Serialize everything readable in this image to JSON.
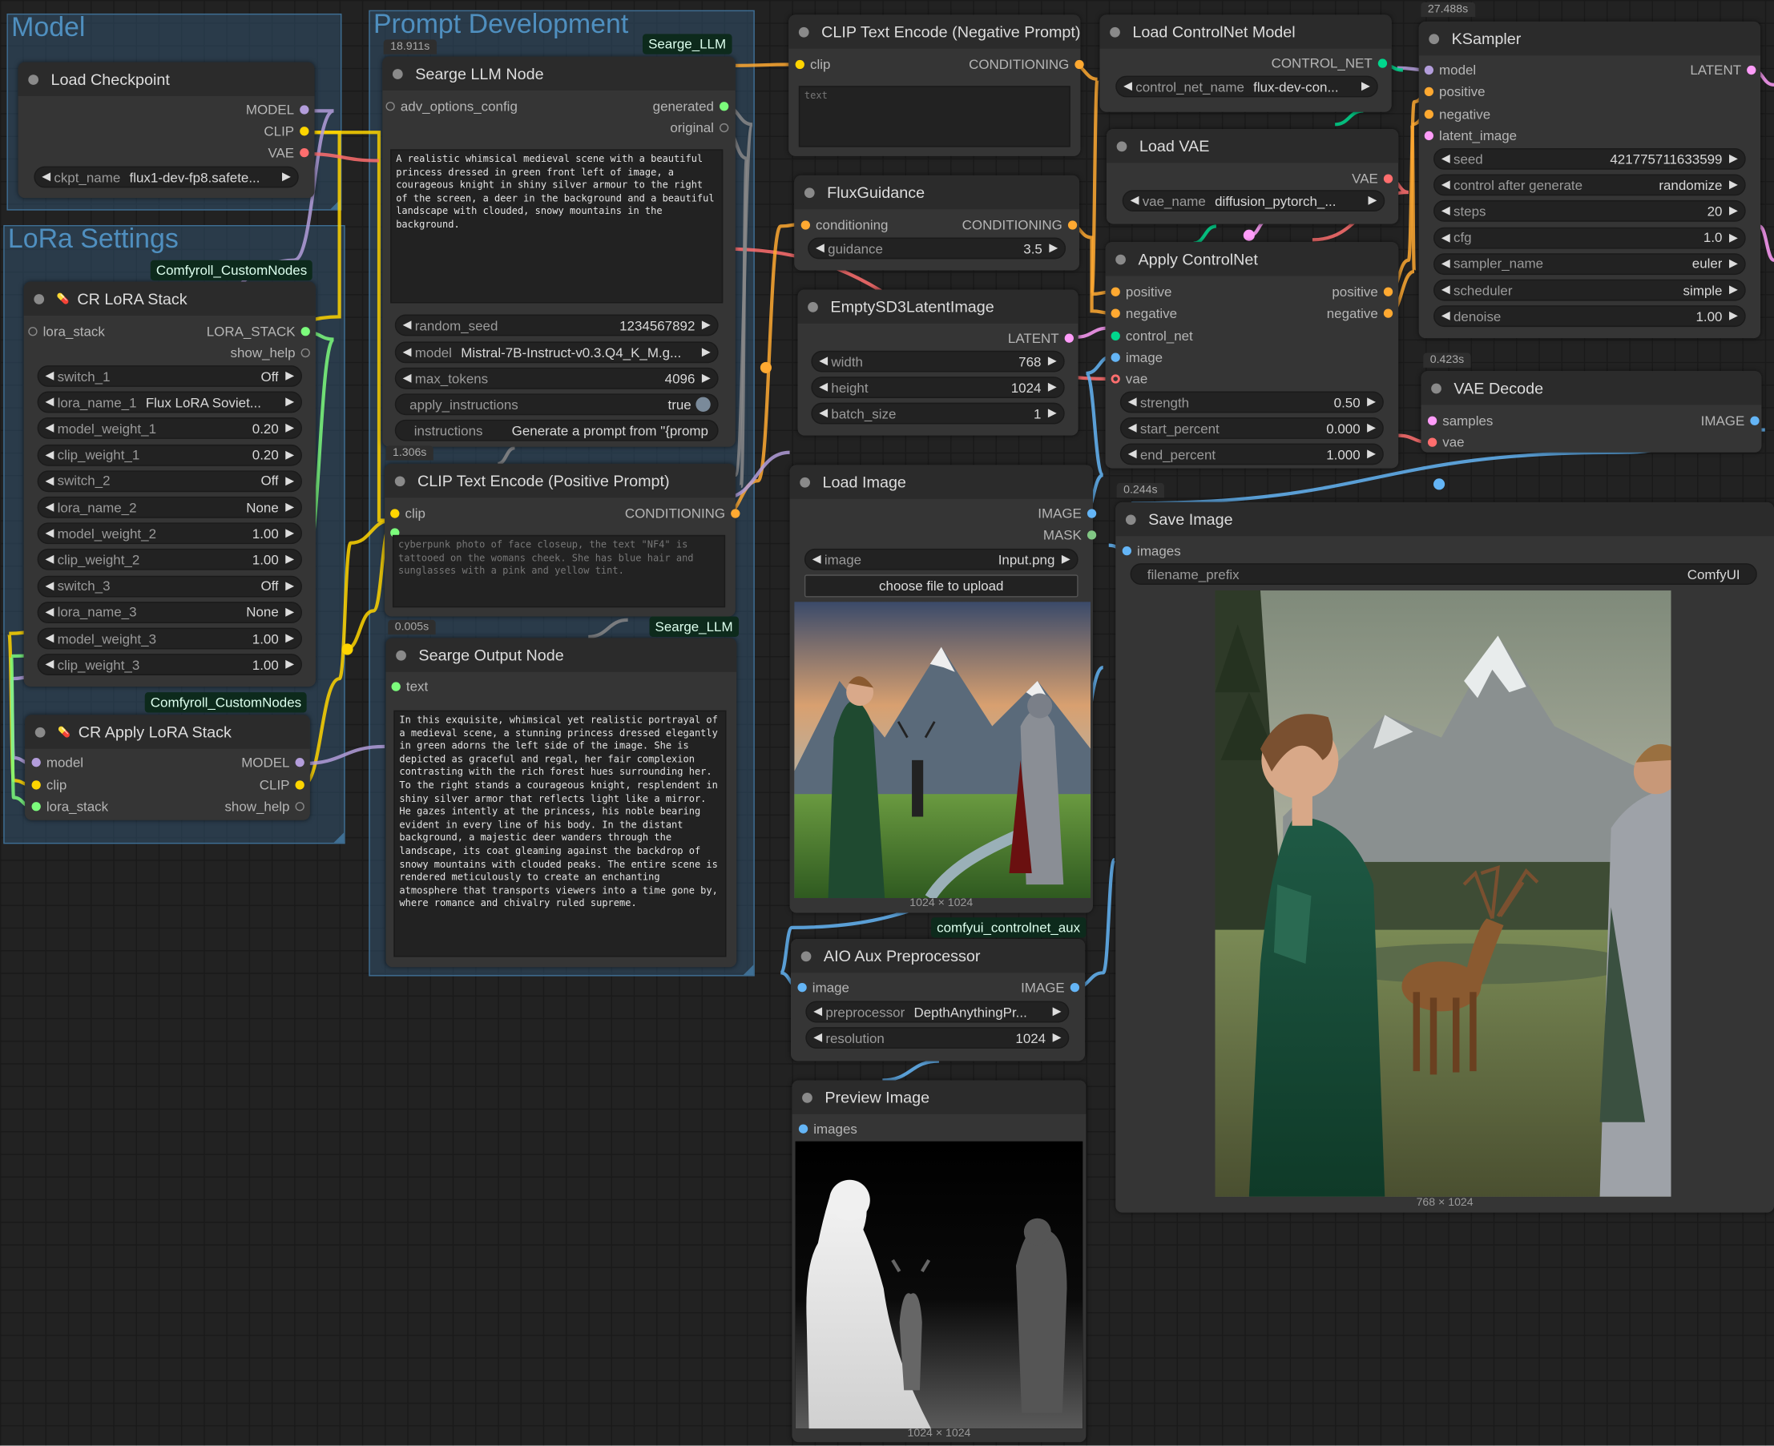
{
  "groups": {
    "model": "Model",
    "prompt": "Prompt Development",
    "lora": "LoRa Settings"
  },
  "badges": {
    "seargellm1": "Searge_LLM",
    "seargellm2": "Searge_LLM",
    "comfyroll1": "Comfyroll_CustomNodes",
    "comfyroll2": "Comfyroll_CustomNodes",
    "controlnetaux": "comfyui_controlnet_aux"
  },
  "times": {
    "llm": "18.911s",
    "clippos": "1.306s",
    "output": "0.005s",
    "ksampler": "27.488s",
    "vaedecode": "0.423s",
    "save": "0.244s"
  },
  "colors": {
    "model": "#b39ddb",
    "clip": "#ffd500",
    "vae": "#ff6e6e",
    "conditioning": "#ffa931",
    "latent": "#ff9cf9",
    "image": "#64b5f6",
    "mask": "#81c784",
    "control_net": "#00d78d",
    "text": "#7cfc7c",
    "lora_stack": "#7cfc7c",
    "generic": "#888888"
  },
  "nodes": {
    "load_checkpoint": {
      "title": "Load Checkpoint",
      "out_model": "MODEL",
      "out_clip": "CLIP",
      "out_vae": "VAE",
      "ckpt_label": "ckpt_name",
      "ckpt_value": "flux1-dev-fp8.safete..."
    },
    "searge_llm": {
      "title": "Searge LLM Node",
      "in_adv": "adv_options_config",
      "out_generated": "generated",
      "out_original": "original",
      "prompt": "A realistic whimsical medieval scene with a beautiful princess dressed in green front left of image, a courageous knight in shiny silver armour to the right of the screen, a deer in the background and a beautiful landscape with clouded, snowy mountains in the background.",
      "w_random_seed": "random_seed",
      "v_random_seed": "1234567892",
      "w_model": "model",
      "v_model": "Mistral-7B-Instruct-v0.3.Q4_K_M.g...",
      "w_max_tokens": "max_tokens",
      "v_max_tokens": "4096",
      "w_apply": "apply_instructions",
      "v_apply": "true",
      "w_instructions": "instructions",
      "v_instructions": "Generate a prompt from \"{promp"
    },
    "cr_lora_stack": {
      "title": "CR LoRA Stack",
      "in_lora_stack": "lora_stack",
      "out_lora_stack": "LORA_STACK",
      "out_show_help": "show_help",
      "widgets": [
        {
          "label": "switch_1",
          "value": "Off"
        },
        {
          "label": "lora_name_1",
          "value": "Flux LoRA Soviet..."
        },
        {
          "label": "model_weight_1",
          "value": "0.20"
        },
        {
          "label": "clip_weight_1",
          "value": "0.20"
        },
        {
          "label": "switch_2",
          "value": "Off"
        },
        {
          "label": "lora_name_2",
          "value": "None"
        },
        {
          "label": "model_weight_2",
          "value": "1.00"
        },
        {
          "label": "clip_weight_2",
          "value": "1.00"
        },
        {
          "label": "switch_3",
          "value": "Off"
        },
        {
          "label": "lora_name_3",
          "value": "None"
        },
        {
          "label": "model_weight_3",
          "value": "1.00"
        },
        {
          "label": "clip_weight_3",
          "value": "1.00"
        }
      ]
    },
    "cr_apply_lora": {
      "title": "CR Apply LoRA Stack",
      "in_model": "model",
      "in_clip": "clip",
      "in_lora_stack": "lora_stack",
      "out_model": "MODEL",
      "out_clip": "CLIP",
      "out_show_help": "show_help"
    },
    "clip_positive": {
      "title": "CLIP Text Encode (Positive Prompt)",
      "in_clip": "clip",
      "out_cond": "CONDITIONING",
      "text": "cyberpunk photo of face closeup, the text \"NF4\" is tattooed on the womans cheek. She has blue hair and sunglasses with a pink and yellow tint."
    },
    "searge_output": {
      "title": "Searge Output Node",
      "in_text": "text",
      "text": "In this exquisite, whimsical yet realistic portrayal of a medieval scene, a stunning princess dressed elegantly in green adorns the left side of the image. She is depicted as graceful and regal, her fair complexion contrasting with the rich forest hues surrounding her. To the right stands a courageous knight, resplendent in shiny silver armor that reflects light like a mirror. He gazes intently at the princess, his noble bearing evident in every line of his body. In the distant background, a majestic deer wanders through the landscape, its coat gleaming against the backdrop of snowy mountains with clouded peaks. The entire scene is rendered meticulously to create an enchanting atmosphere that transports viewers into a time gone by, where romance and chivalry ruled supreme."
    },
    "clip_negative": {
      "title": "CLIP Text Encode (Negative Prompt)",
      "in_clip": "clip",
      "out_cond": "CONDITIONING",
      "placeholder": "text"
    },
    "flux_guidance": {
      "title": "FluxGuidance",
      "in_cond": "conditioning",
      "out_cond": "CONDITIONING",
      "w_guidance": "guidance",
      "v_guidance": "3.5"
    },
    "empty_latent": {
      "title": "EmptySD3LatentImage",
      "out_latent": "LATENT",
      "w_width": "width",
      "v_width": "768",
      "w_height": "height",
      "v_height": "1024",
      "w_batch": "batch_size",
      "v_batch": "1"
    },
    "load_image": {
      "title": "Load Image",
      "out_image": "IMAGE",
      "out_mask": "MASK",
      "w_image": "image",
      "v_image": "Input.png",
      "upload": "choose file to upload",
      "dims": "1024 × 1024"
    },
    "aio_aux": {
      "title": "AIO Aux Preprocessor",
      "in_image": "image",
      "out_image": "IMAGE",
      "w_pre": "preprocessor",
      "v_pre": "DepthAnythingPr...",
      "w_res": "resolution",
      "v_res": "1024"
    },
    "preview_image": {
      "title": "Preview Image",
      "in_images": "images",
      "dims": "1024 × 1024"
    },
    "load_controlnet": {
      "title": "Load ControlNet Model",
      "out_cn": "CONTROL_NET",
      "w_name": "control_net_name",
      "v_name": "flux-dev-con..."
    },
    "load_vae": {
      "title": "Load VAE",
      "out_vae": "VAE",
      "w_name": "vae_name",
      "v_name": "diffusion_pytorch_..."
    },
    "apply_controlnet": {
      "title": "Apply ControlNet",
      "in_positive": "positive",
      "in_negative": "negative",
      "in_cn": "control_net",
      "in_image": "image",
      "in_vae": "vae",
      "out_positive": "positive",
      "out_negative": "negative",
      "w_strength": "strength",
      "v_strength": "0.50",
      "w_start": "start_percent",
      "v_start": "0.000",
      "w_end": "end_percent",
      "v_end": "1.000"
    },
    "ksampler": {
      "title": "KSampler",
      "in_model": "model",
      "in_positive": "positive",
      "in_negative": "negative",
      "in_latent": "latent_image",
      "out_latent": "LATENT",
      "widgets": [
        {
          "label": "seed",
          "value": "421775711633599"
        },
        {
          "label": "control after generate",
          "value": "randomize"
        },
        {
          "label": "steps",
          "value": "20"
        },
        {
          "label": "cfg",
          "value": "1.0"
        },
        {
          "label": "sampler_name",
          "value": "euler"
        },
        {
          "label": "scheduler",
          "value": "simple"
        },
        {
          "label": "denoise",
          "value": "1.00"
        }
      ]
    },
    "vae_decode": {
      "title": "VAE Decode",
      "in_samples": "samples",
      "in_vae": "vae",
      "out_image": "IMAGE"
    },
    "save_image": {
      "title": "Save Image",
      "in_images": "images",
      "w_prefix": "filename_prefix",
      "v_prefix": "ComfyUI",
      "dims": "768 × 1024"
    }
  }
}
